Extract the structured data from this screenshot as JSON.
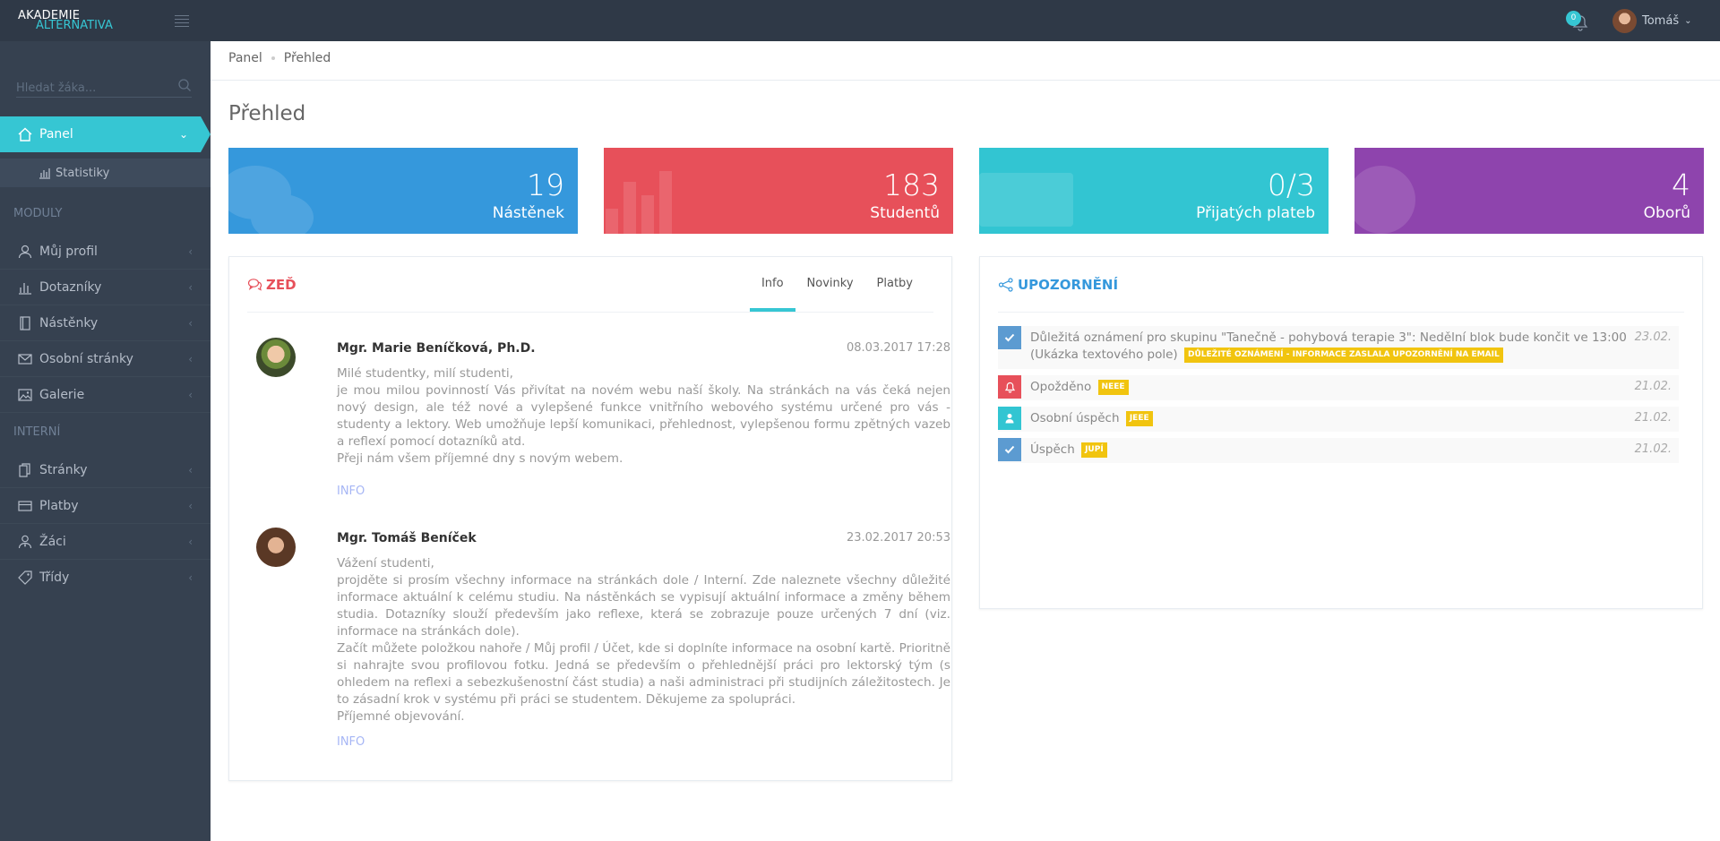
{
  "app": {
    "logo_line1": "AKADEMIE",
    "logo_line2": "ALTERNATIVA",
    "notifications_count": "0",
    "user_name": "Tomáš"
  },
  "sidebar": {
    "search_placeholder": "Hledat žáka...",
    "active_item": "Panel",
    "sub_item": "Statistiky",
    "section_modules": "MODULY",
    "modules": [
      "Můj profil",
      "Dotazníky",
      "Nástěnky",
      "Osobní stránky",
      "Galerie"
    ],
    "section_internal": "INTERNÍ",
    "internal": [
      "Stránky",
      "Platby",
      "Žáci",
      "Třídy"
    ]
  },
  "breadcrumb": [
    "Panel",
    "Přehled"
  ],
  "page_title": "Přehled",
  "stats": [
    {
      "value": "19",
      "label": "Nástěnek",
      "color": "#3598dc"
    },
    {
      "value": "183",
      "label": "Studentů",
      "color": "#e7505a"
    },
    {
      "value": "0/3",
      "label": "Přijatých plateb",
      "color": "#32c5d2"
    },
    {
      "value": "4",
      "label": "Oborů",
      "color": "#8e44ad"
    }
  ],
  "wall": {
    "title": "ZEĎ",
    "tabs": [
      "Info",
      "Novinky",
      "Platby"
    ],
    "posts": [
      {
        "author": "Mgr. Marie Beníčková, Ph.D.",
        "date": "08.03.2017 17:28",
        "body": [
          "Milé studentky, milí studenti,",
          "je mou milou povinností Vás přivítat na novém webu naší školy. Na stránkách na vás čeká nejen nový design, ale též nové a vylepšené funkce vnitřního webového systému určené pro vás -  studenty a lektory. Web  umožňuje lepší komunikaci, přehlednost, vylepšenou formu zpětných vazeb a reflexí pomocí dotazníků atd.",
          "Přeji nám všem příjemné dny s novým webem."
        ],
        "tag": "INFO"
      },
      {
        "author": "Mgr. Tomáš Beníček",
        "date": "23.02.2017 20:53",
        "body": [
          "Vážení studenti,",
          "projděte si prosím všechny informace na stránkách dole / Interní. Zde naleznete všechny důležité informace aktuální k celému studiu. Na nástěnkách se vypisují aktuální informace a změny během studia. Dotazníky slouží především jako reflexe, která se zobrazuje pouze určených 7 dní (viz. informace na stránkách dole).",
          "Začít můžete položkou nahoře / Můj profil / Účet, kde si doplníte informace na osobní kartě. Prioritně si nahrajte svou profilovou fotku. Jedná se především o přehlednější práci pro lektorský tým (s ohledem na reflexi a sebezkušenostní část studia) a naši administraci při studijních záležitostech. Je to zásadní krok v systému při práci se studentem. Děkujeme za spolupráci.",
          "Příjemné objevování."
        ],
        "tag": "INFO"
      }
    ]
  },
  "notices": {
    "title": "UPOZORNĚNÍ",
    "items": [
      {
        "text": "Důležitá oznámení pro skupinu \"Tanečně - pohybová terapie 3\": Nedělní blok bude končit ve 13:00 (Ukázka textového pole)",
        "badge": "DŮLEŽITÉ OZNÁMENÍ - INFORMACE ZASLALA UPOZORNĚNÍ NA EMAIL",
        "date": "23.02.",
        "icon": "check-icon",
        "color": "#5c9bd1"
      },
      {
        "text": "Opožděno",
        "badge": "NEEE",
        "date": "21.02.",
        "icon": "bell-icon",
        "color": "#e7505a"
      },
      {
        "text": "Osobní úspěch",
        "badge": "JEEE",
        "date": "21.02.",
        "icon": "user-icon",
        "color": "#32c5d2"
      },
      {
        "text": "Úspěch",
        "badge": "JUPÍ",
        "date": "21.02.",
        "icon": "check-icon",
        "color": "#5c9bd1"
      }
    ]
  }
}
